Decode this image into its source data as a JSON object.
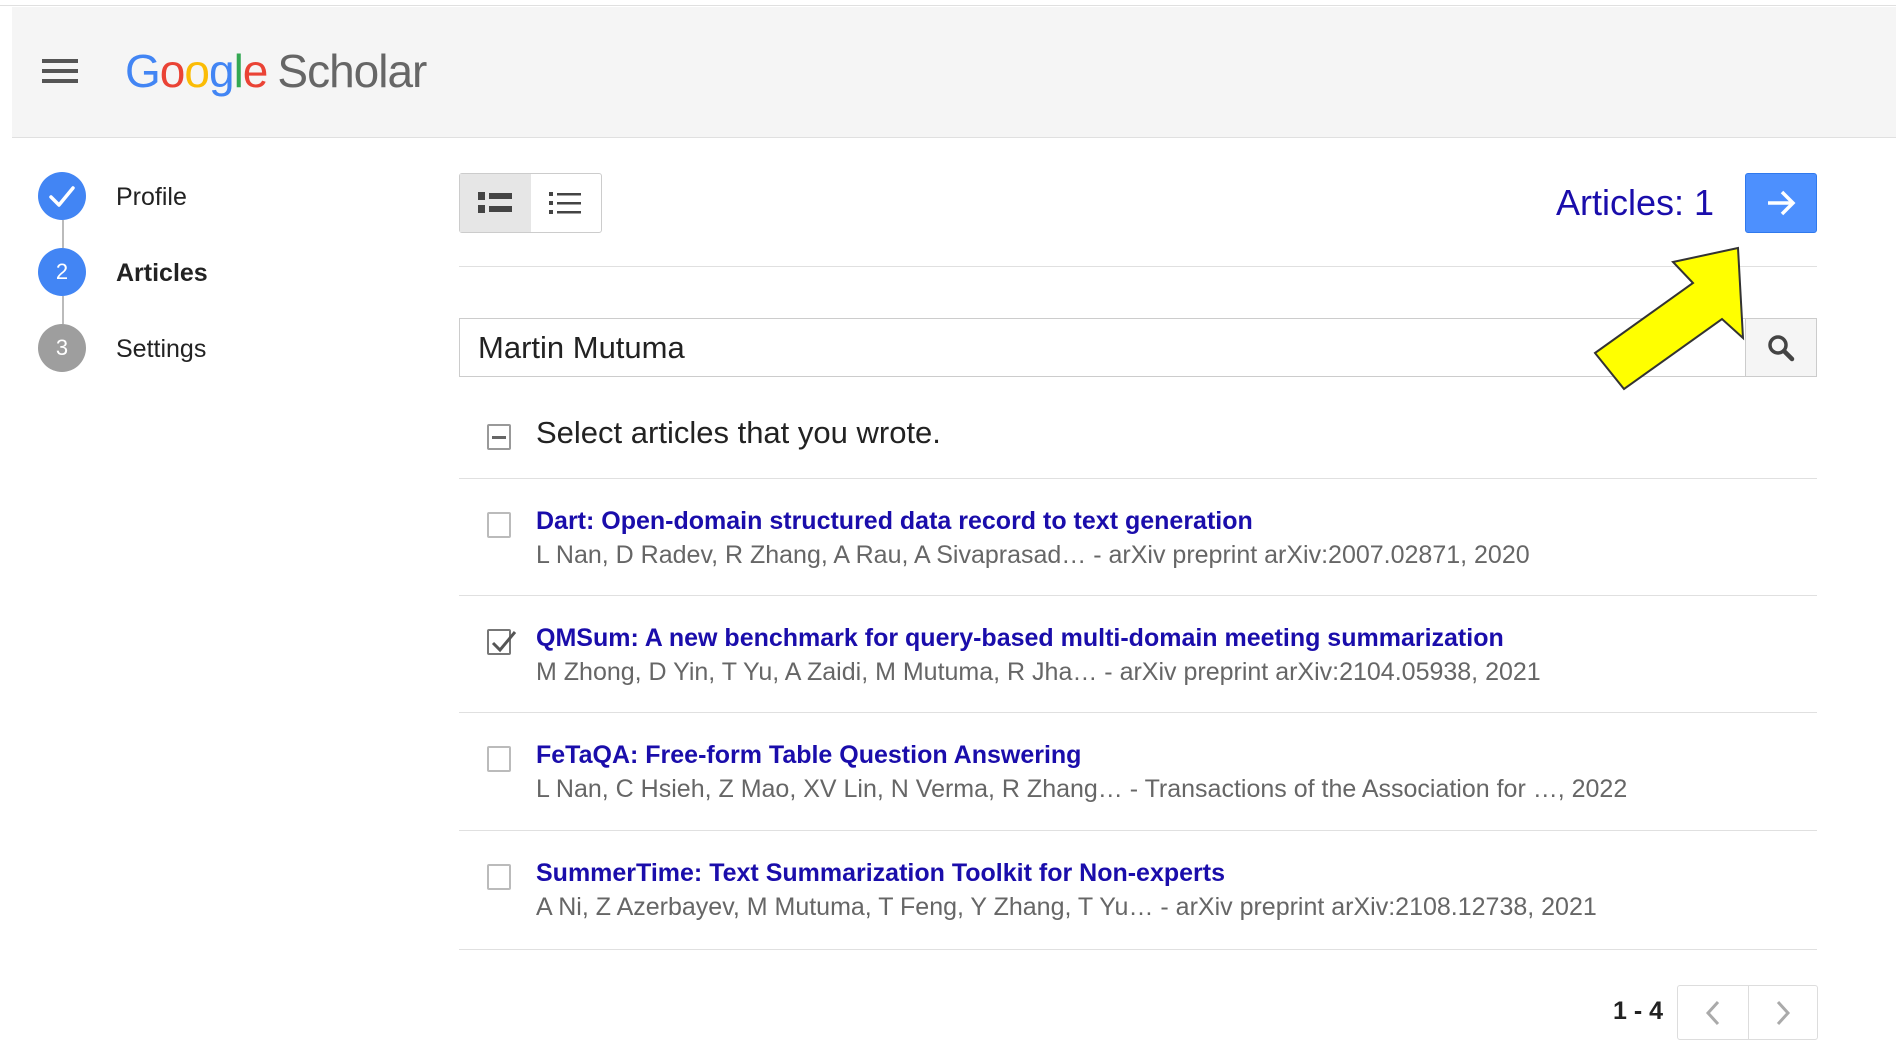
{
  "header": {
    "logo_google": "Google",
    "logo_scholar": "Scholar"
  },
  "stepper": {
    "steps": [
      {
        "number": "",
        "label": "Profile",
        "state": "done",
        "color": "#4285f4"
      },
      {
        "number": "2",
        "label": "Articles",
        "state": "active",
        "color": "#4285f4"
      },
      {
        "number": "3",
        "label": "Settings",
        "state": "pending",
        "color": "#9e9e9e"
      }
    ]
  },
  "toolbar": {
    "articles_count": "Articles: 1",
    "next_icon": "arrow-right-icon",
    "view_modes": [
      "detailed-list-icon",
      "compact-list-icon"
    ]
  },
  "search": {
    "value": "Martin Mutuma",
    "icon": "search-icon"
  },
  "select_heading": "Select articles that you wrote.",
  "articles": [
    {
      "title": "Dart: Open-domain structured data record to text generation",
      "meta": "L Nan, D Radev, R Zhang, A Rau, A Sivaprasad… - arXiv preprint arXiv:2007.02871, 2020",
      "checked": false
    },
    {
      "title": "QMSum: A new benchmark for query-based multi-domain meeting summarization",
      "meta": "M Zhong, D Yin, T Yu, A Zaidi, M Mutuma, R Jha… - arXiv preprint arXiv:2104.05938, 2021",
      "checked": true
    },
    {
      "title": "FeTaQA: Free-form Table Question Answering",
      "meta": "L Nan, C Hsieh, Z Mao, XV Lin, N Verma, R Zhang… - Transactions of the Association for …, 2022",
      "checked": false
    },
    {
      "title": "SummerTime: Text Summarization Toolkit for Non-experts",
      "meta": "A Ni, Z Azerbayev, M Mutuma, T Feng, Y Zhang, T Yu… - arXiv preprint arXiv:2108.12738, 2021",
      "checked": false
    }
  ],
  "pagination": {
    "range": "1 - 4",
    "prev_icon": "chevron-left-icon",
    "next_icon": "chevron-right-icon"
  },
  "colors": {
    "accent_blue": "#4d90fe",
    "link": "#1a0dab",
    "annotation_arrow": "#ffff00"
  }
}
